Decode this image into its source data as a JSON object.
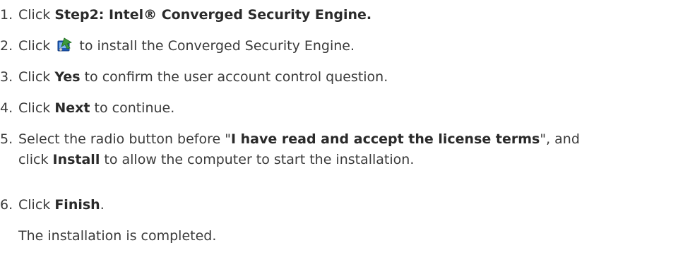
{
  "steps": [
    {
      "number": "1.",
      "segments": [
        {
          "text": "Click ",
          "bold": false
        },
        {
          "text": "Step2: Intel® Converged Security Engine.",
          "bold": true
        }
      ]
    },
    {
      "number": "2.",
      "before_icon": "Click ",
      "icon": "install-setup-icon",
      "after_icon": " to install the Converged Security Engine."
    },
    {
      "number": "3.",
      "segments": [
        {
          "text": "Click ",
          "bold": false
        },
        {
          "text": "Yes",
          "bold": true
        },
        {
          "text": " to confirm the user account control question.",
          "bold": false
        }
      ]
    },
    {
      "number": "4.",
      "segments": [
        {
          "text": "Click ",
          "bold": false
        },
        {
          "text": "Next",
          "bold": true
        },
        {
          "text": " to continue.",
          "bold": false
        }
      ]
    },
    {
      "number": "5.",
      "line1": [
        {
          "text": "Select the radio button before \"",
          "bold": false
        },
        {
          "text": "I have read and accept the license terms",
          "bold": true
        },
        {
          "text": "\", and",
          "bold": false
        }
      ],
      "line2": [
        {
          "text": "click ",
          "bold": false
        },
        {
          "text": "Install",
          "bold": true
        },
        {
          "text": " to allow the computer to start the installation.",
          "bold": false
        }
      ]
    },
    {
      "number": "6.",
      "segments": [
        {
          "text": "Click ",
          "bold": false
        },
        {
          "text": "Finish",
          "bold": true
        },
        {
          "text": ".",
          "bold": false
        }
      ]
    }
  ],
  "result_note": "The installation is completed.",
  "colors": {
    "text": "#3a3a3a",
    "icon_blue": "#1e5bb8",
    "icon_green": "#3c9a3c"
  }
}
